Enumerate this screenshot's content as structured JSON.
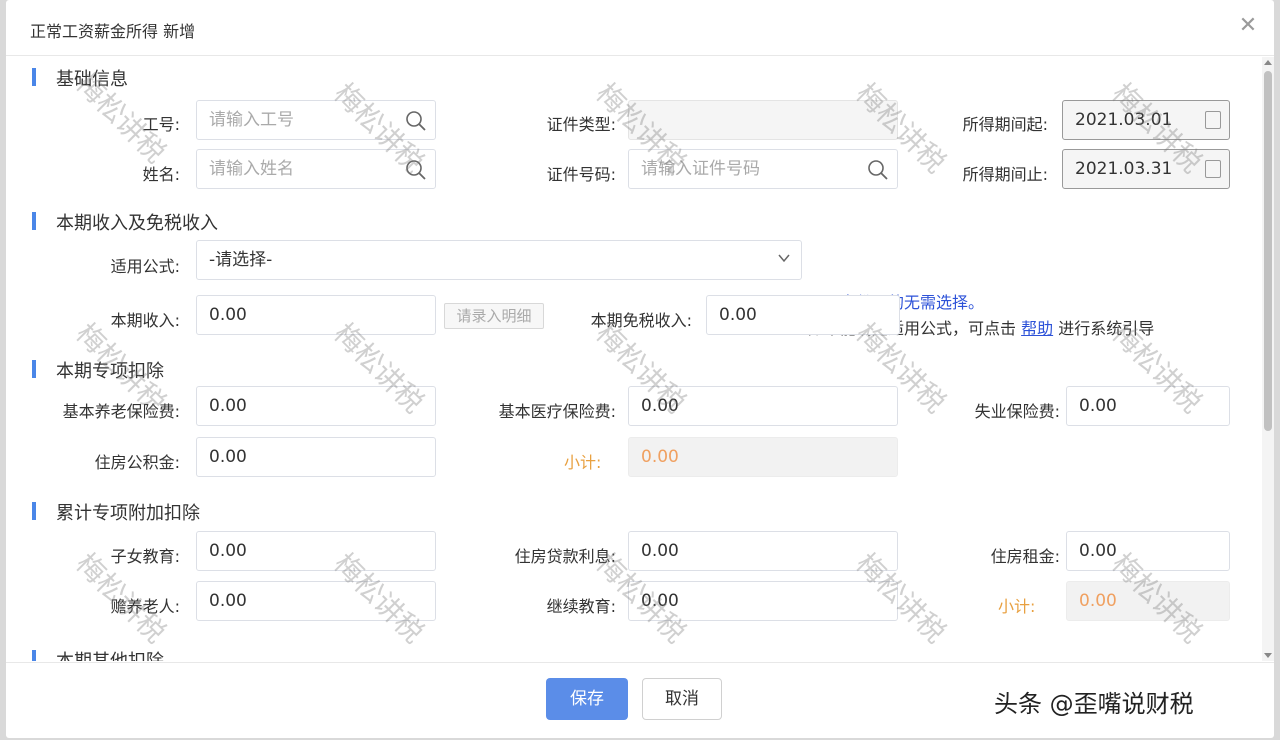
{
  "dialog": {
    "title": "正常工资薪金所得 新增",
    "close_icon": "close-icon"
  },
  "sections": {
    "basic": "基础信息",
    "income": "本期收入及免税收入",
    "special": "本期专项扣除",
    "cumulative": "累计专项附加扣除",
    "other": "本期其他扣除"
  },
  "basic": {
    "id_label": "工号:",
    "id_placeholder": "请输入工号",
    "name_label": "姓名:",
    "name_placeholder": "请输入姓名",
    "cert_type_label": "证件类型:",
    "cert_type_value": "",
    "cert_no_label": "证件号码:",
    "cert_no_placeholder": "请输入证件号码",
    "period_start_label": "所得期间起:",
    "period_start_value": "2021.03.01",
    "period_end_label": "所得期间止:",
    "period_end_value": "2021.03.31"
  },
  "income": {
    "formula_label": "适用公式:",
    "formula_value": "-请选择-",
    "hint_line1": "居民身份证的无需选择。",
    "hint_line2_pre": "如不能确定适用公式，可点击",
    "hint_link": "帮助",
    "hint_line2_post": "进行系统引导",
    "current_income_label": "本期收入:",
    "current_income_value": "0.00",
    "detail_button": "请录入明细",
    "exempt_income_label": "本期免税收入:",
    "exempt_income_value": "0.00"
  },
  "special": {
    "pension_label": "基本养老保险费:",
    "pension_value": "0.00",
    "medical_label": "基本医疗保险费:",
    "medical_value": "0.00",
    "unemployment_label": "失业保险费:",
    "unemployment_value": "0.00",
    "housing_fund_label": "住房公积金:",
    "housing_fund_value": "0.00",
    "subtotal_label": "小计:",
    "subtotal_value": "0.00"
  },
  "cumulative": {
    "children_label": "子女教育:",
    "children_value": "0.00",
    "loan_label": "住房贷款利息:",
    "loan_value": "0.00",
    "rent_label": "住房租金:",
    "rent_value": "0.00",
    "elderly_label": "赡养老人:",
    "elderly_value": "0.00",
    "education_label": "继续教育:",
    "education_value": "0.00",
    "subtotal_label": "小计:",
    "subtotal_value": "0.00"
  },
  "footer": {
    "save": "保存",
    "cancel": "取消"
  },
  "watermark": "梅松讲税",
  "credit": "头条 @歪嘴说财税",
  "colors": {
    "accent": "#4a86e8",
    "primary_button": "#5b8de8",
    "subtotal": "#f0a060",
    "link": "#2d52d8"
  }
}
